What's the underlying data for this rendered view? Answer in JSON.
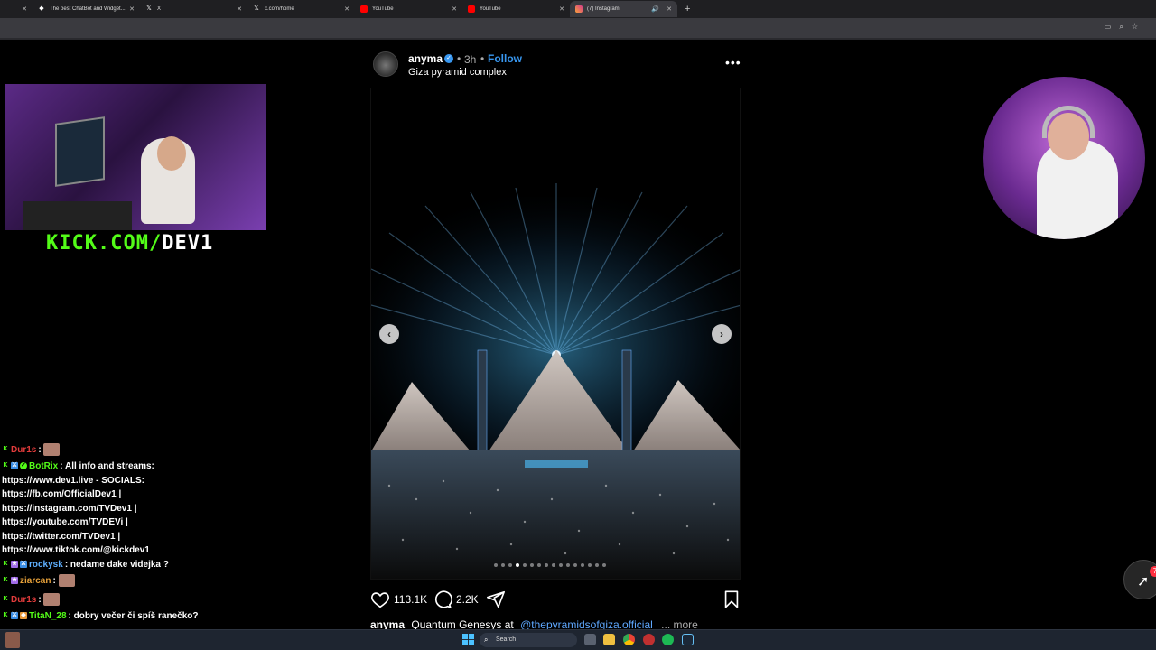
{
  "browser": {
    "tabs": [
      {
        "title": "",
        "icon": "blank-icon"
      },
      {
        "title": "The best ChatBot and Widget...",
        "icon": "botrix-icon"
      },
      {
        "title": "X",
        "icon": "x-logo-icon"
      },
      {
        "title": "x.com/home",
        "icon": "x-logo-icon"
      },
      {
        "title": "YouTube",
        "icon": "youtube-icon"
      },
      {
        "title": "YouTube",
        "icon": "youtube-icon"
      },
      {
        "title": "(7) Instagram",
        "icon": "instagram-icon"
      }
    ],
    "new_tab_label": "+"
  },
  "stream": {
    "kick_logo_green": "KICK.COM/",
    "kick_logo_white": "DEV1"
  },
  "chat": {
    "messages": [
      {
        "user": "Dur1s",
        "user_color": "#e23b3b",
        "text": "",
        "badges": [
          "k"
        ],
        "emote": true
      },
      {
        "user": "BotRix",
        "user_color": "#53fc18",
        "text": "All info and streams:",
        "badges": [
          "k",
          "mod",
          "ok"
        ],
        "emote": false
      },
      {
        "user": "",
        "user_color": "#fff",
        "text": "https://www.dev1.live - SOCIALS:",
        "badges": [],
        "emote": false
      },
      {
        "user": "",
        "user_color": "#fff",
        "text": "https://fb.com/OfficialDev1 |",
        "badges": [],
        "emote": false
      },
      {
        "user": "",
        "user_color": "#fff",
        "text": "https://instagram.com/TVDev1 |",
        "badges": [],
        "emote": false
      },
      {
        "user": "",
        "user_color": "#fff",
        "text": "https://youtube.com/TVDEVi |",
        "badges": [],
        "emote": false
      },
      {
        "user": "",
        "user_color": "#fff",
        "text": "https://twitter.com/TVDev1 |",
        "badges": [],
        "emote": false
      },
      {
        "user": "",
        "user_color": "#fff",
        "text": "https://www.tiktok.com/@kickdev1",
        "badges": [],
        "emote": false
      },
      {
        "user": "rockysk",
        "user_color": "#5fb0ff",
        "text": "nedame dake videjka ?",
        "badges": [
          "k",
          "sub",
          "mod"
        ],
        "emote": false
      },
      {
        "user": "ziarcan",
        "user_color": "#e8a23a",
        "text": "",
        "badges": [
          "k",
          "sub"
        ],
        "emote": true
      },
      {
        "user": "Dur1s",
        "user_color": "#e23b3b",
        "text": "",
        "badges": [
          "k"
        ],
        "emote": true
      },
      {
        "user": "TitaN_28",
        "user_color": "#53fc18",
        "text": "dobry večer či spíš ranečko?",
        "badges": [
          "k",
          "mod",
          "vip"
        ],
        "emote": false
      }
    ]
  },
  "post": {
    "username": "anyma",
    "verified_mark": "✓",
    "separator": "•",
    "time": "3h",
    "follow_label": "Follow",
    "location": "Giza pyramid complex",
    "more_label": "•••",
    "prev_label": "‹",
    "next_label": "›",
    "carousel_count": 16,
    "carousel_active_index": 3,
    "likes": "113.1K",
    "comments": "2.2K",
    "caption_user": "anyma",
    "caption_text": "Quantum Genesys at",
    "caption_mention": "@thepyramidsofgiza.official",
    "caption_more": "... more"
  },
  "messages_fab": {
    "badge_count": "7"
  },
  "taskbar": {
    "search_placeholder": "Search",
    "pinned_icons": [
      "task-view-icon",
      "file-explorer-icon",
      "chrome-icon",
      "app-icon",
      "spotify-icon",
      "steam-icon"
    ]
  },
  "colors": {
    "accent_blue": "#3897f0",
    "kick_green": "#53fc18",
    "background": "#000000"
  }
}
